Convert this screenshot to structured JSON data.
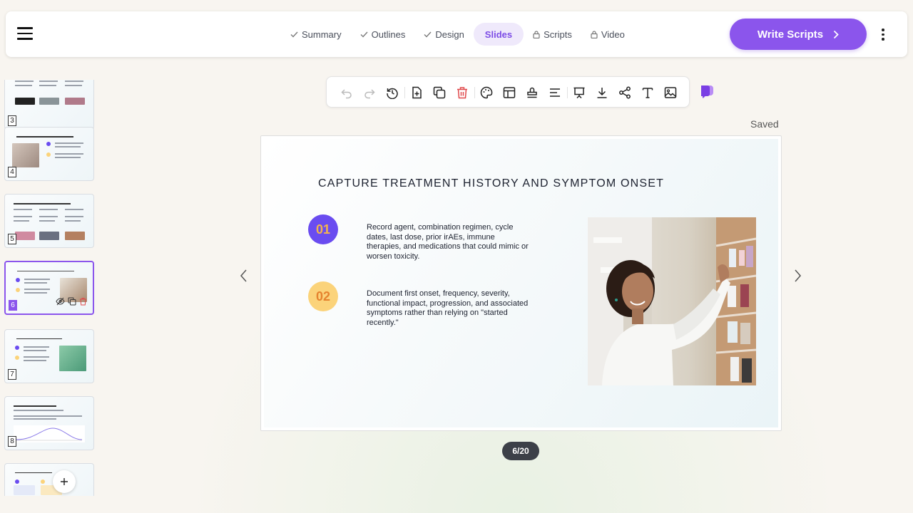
{
  "nav": {
    "steps": [
      {
        "label": "Summary",
        "state": "done"
      },
      {
        "label": "Outlines",
        "state": "done"
      },
      {
        "label": "Design",
        "state": "done"
      },
      {
        "label": "Slides",
        "state": "active"
      },
      {
        "label": "Scripts",
        "state": "locked"
      },
      {
        "label": "Video",
        "state": "locked"
      }
    ],
    "cta_label": "Write Scripts"
  },
  "thumbnails": [
    {
      "number": "3"
    },
    {
      "number": "4"
    },
    {
      "number": "5"
    },
    {
      "number": "6"
    },
    {
      "number": "7"
    },
    {
      "number": "8"
    }
  ],
  "toolbar": {
    "icons": [
      "undo-icon",
      "redo-icon",
      "history-icon",
      "add-slide-icon",
      "duplicate-icon",
      "delete-icon",
      "palette-icon",
      "layout-icon",
      "stamp-icon",
      "align-icon",
      "present-icon",
      "download-icon",
      "share-icon",
      "text-icon",
      "image-icon"
    ]
  },
  "status": {
    "saved": "Saved"
  },
  "slide": {
    "title": "CAPTURE TREATMENT HISTORY AND SYMPTOM ONSET",
    "points": [
      {
        "number": "01",
        "text": "Record agent, combination regimen, cycle dates, last dose, prior irAEs, immune therapies, and medications that could mimic or worsen toxicity."
      },
      {
        "number": "02",
        "text": "Document first onset, frequency, severity, functional impact, progression, and associated symptoms rather than relying on \"started recently.\""
      }
    ]
  },
  "pager": {
    "counter": "6/20"
  },
  "colors": {
    "accent": "#8b55ec",
    "badge1": "#6a4cf0",
    "badge2": "#fbd37a",
    "delete": "#e0484a"
  }
}
